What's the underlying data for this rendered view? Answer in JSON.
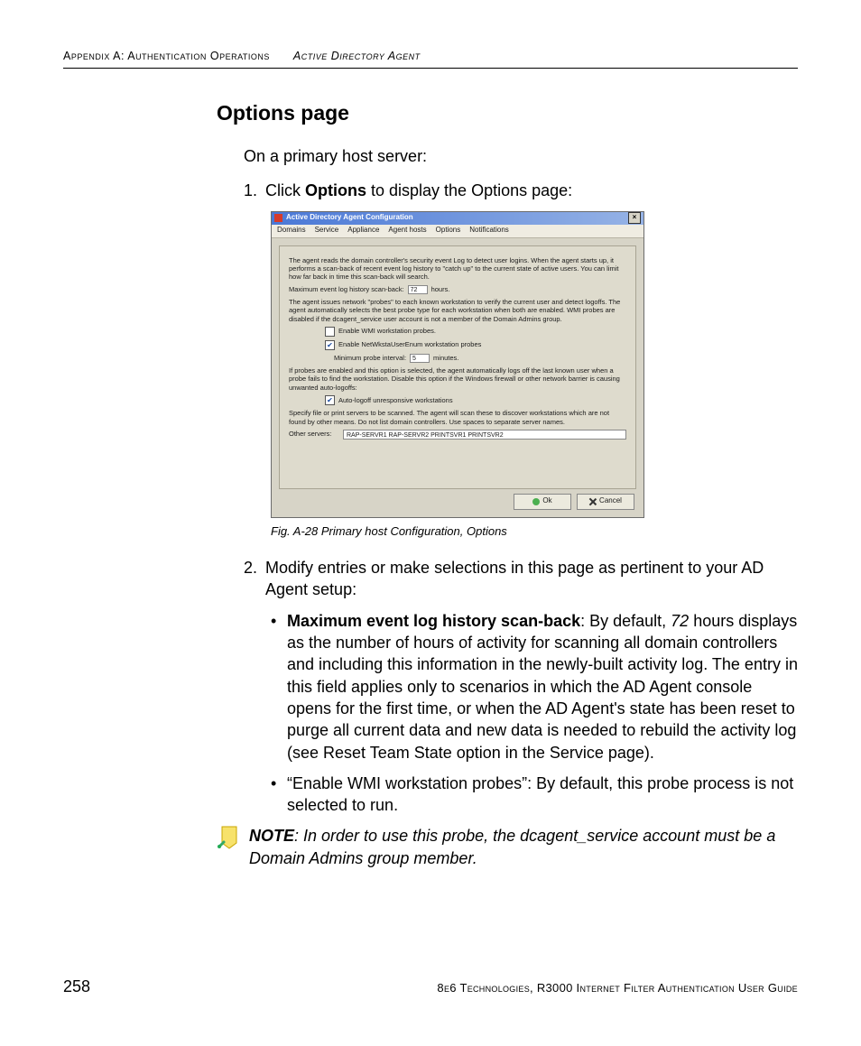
{
  "header": {
    "left": "Appendix A: Authentication Operations",
    "right": "Active Directory Agent"
  },
  "section_title": "Options page",
  "intro": "On a primary host server:",
  "step1": {
    "num": "1.",
    "pre": "Click ",
    "bold": "Options",
    "post": " to display the Options page:"
  },
  "dialog": {
    "title": "Active Directory Agent Configuration",
    "menu": [
      "Domains",
      "Service",
      "Appliance",
      "Agent hosts",
      "Options",
      "Notifications"
    ],
    "para1": "The agent reads the domain controller's security event Log to detect user logins. When the agent starts up, it performs a scan-back of recent event log history to \"catch up\" to the current state of active users.   You can limit how far back in time this scan-back will search.",
    "scanback_label": "Maximum event log history scan-back:",
    "scanback_value": "72",
    "scanback_unit": "hours.",
    "para2": "The agent issues network \"probes\" to each known workstation to verify the current user and detect logoffs.   The agent automatically selects the best probe type for each workstation when both are enabled.  WMI probes are disabled if the dcagent_service user account is not a member of the Domain Admins group.",
    "chk_wmi": "Enable WMI workstation probes.",
    "chk_netwksta": "Enable NetWkstaUserEnum workstation probes",
    "probe_label": "Minimum probe interval:",
    "probe_value": "5",
    "probe_unit": "minutes.",
    "para3": "If probes are enabled and this option is selected, the agent automatically logs off the last known user when a probe fails to find the workstation.  Disable this option if the Windows firewall or other network barrier is causing unwanted auto-logoffs:",
    "chk_autologoff": "Auto-logoff unresponsive workstations",
    "para4": "Specify file or print servers to be scanned.   The agent will scan these to discover workstations which are not found by other means.   Do not list domain controllers.  Use spaces to separate server names.",
    "other_label": "Other servers:",
    "other_value": "RAP-SERVR1 RAP-SERVR2 PRINTSVR1 PRINTSVR2",
    "ok": "Ok",
    "cancel": "Cancel"
  },
  "fig_caption": "Fig. A-28  Primary host Configuration, Options",
  "step2": {
    "num": "2.",
    "text": "Modify entries or make selections in this page as pertinent to your AD Agent setup:"
  },
  "bullet1": {
    "bold": "Maximum event log history scan-back",
    "after_bold": ": By default, ",
    "italic": "72",
    "rest": " hours displays as the number of hours of activity for scanning all domain controllers and including this information in the newly-built activity log. The entry in this field applies only to scenarios in which the AD Agent console opens for the first time, or when the AD Agent's state has been reset to purge all current data and new data is needed to rebuild the activity log (see Reset Team State option in the Service page)."
  },
  "bullet2": "“Enable WMI workstation probes”: By default, this probe process is not selected to run.",
  "note": {
    "label": "NOTE",
    "text": ": In order to use this probe, the dcagent_service account must be a Domain Admins group member."
  },
  "footer": {
    "page": "258",
    "text": "8e6 Technologies, R3000 Internet Filter Authentication User Guide"
  }
}
